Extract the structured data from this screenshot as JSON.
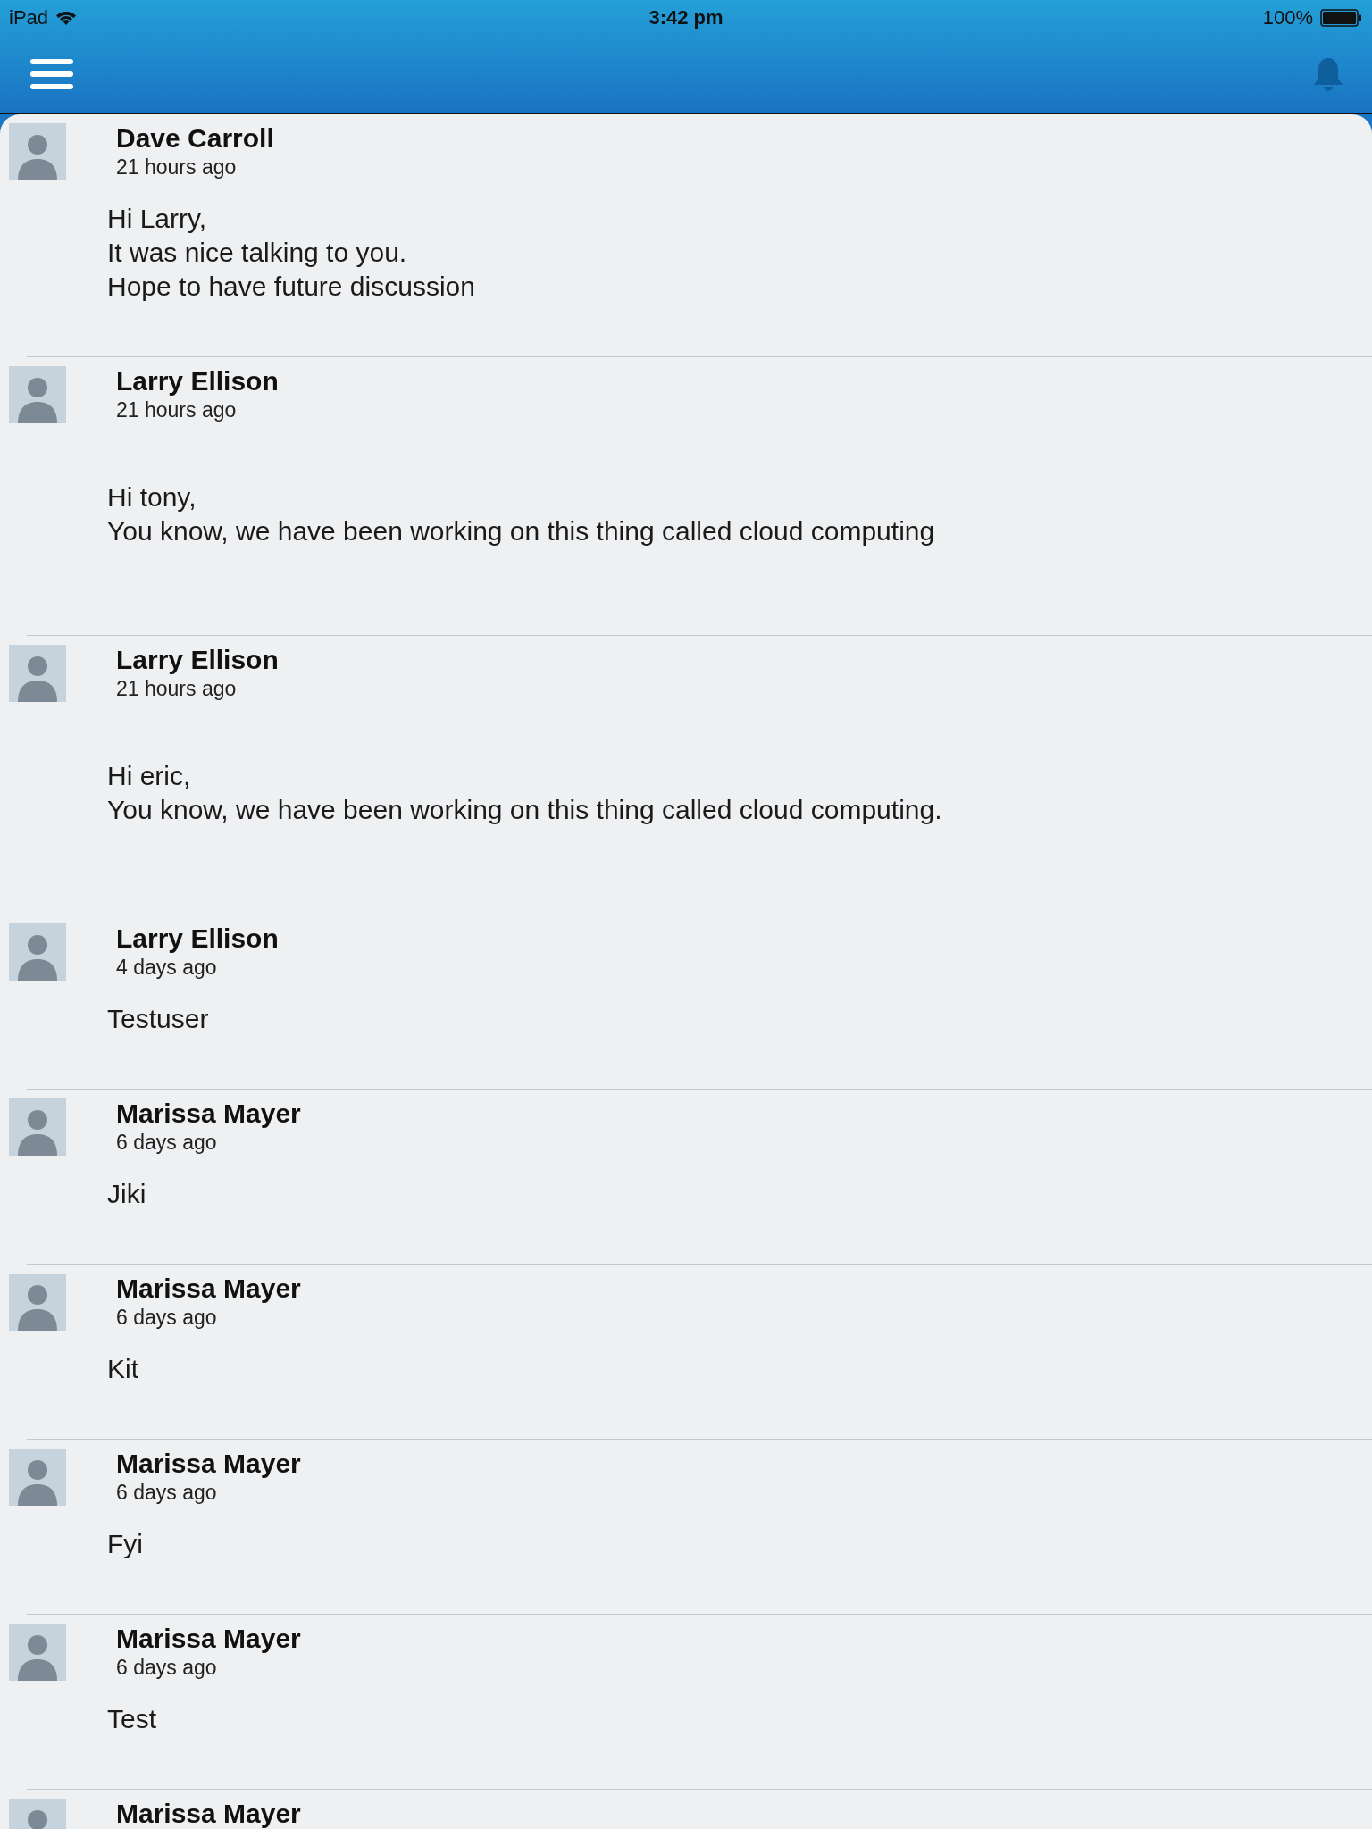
{
  "status_bar": {
    "device": "iPad",
    "time": "3:42 pm",
    "battery": "100%"
  },
  "messages": [
    {
      "author": "Dave Carroll",
      "time": "21 hours ago",
      "lines": [
        "Hi Larry,",
        "It was nice talking to you.",
        "Hope to have future discussion"
      ]
    },
    {
      "author": "Larry Ellison",
      "time": "21 hours ago",
      "lines": [
        "Hi tony,",
        "You know, we have been working on this thing called cloud computing"
      ]
    },
    {
      "author": "Larry Ellison",
      "time": "21 hours ago",
      "lines": [
        "Hi eric,",
        "You know, we have been working on this thing called cloud computing."
      ]
    },
    {
      "author": "Larry Ellison",
      "time": "4 days ago",
      "lines": [
        "Testuser"
      ]
    },
    {
      "author": "Marissa Mayer",
      "time": "6 days ago",
      "lines": [
        "Jiki"
      ]
    },
    {
      "author": "Marissa Mayer",
      "time": "6 days ago",
      "lines": [
        "Kit"
      ]
    },
    {
      "author": "Marissa Mayer",
      "time": "6 days ago",
      "lines": [
        "Fyi"
      ]
    },
    {
      "author": "Marissa Mayer",
      "time": "6 days ago",
      "lines": [
        "Test"
      ]
    },
    {
      "author": "Marissa Mayer"
    }
  ]
}
